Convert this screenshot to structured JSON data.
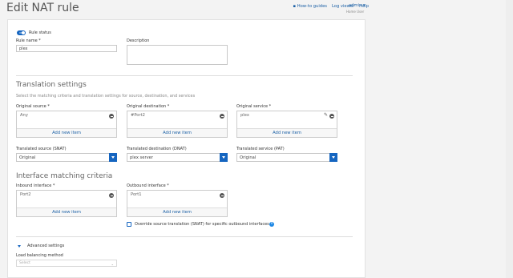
{
  "page": {
    "title": "Edit NAT rule"
  },
  "toplinks": {
    "howto": "How-to guides",
    "log": "Log viewer",
    "help": "Help",
    "user": "admin ▾",
    "role": "Home User"
  },
  "rule": {
    "toggle_text": "ON",
    "status_label": "Rule status",
    "name_label": "Rule name *",
    "name_value": "plex",
    "desc_label": "Description",
    "desc_value": ""
  },
  "translation": {
    "title": "Translation settings",
    "hint": "Select the matching criteria and translation settings for source, destination, and services",
    "orig_source_label": "Original source *",
    "orig_source_item": "Any",
    "orig_dest_label": "Original destination *",
    "orig_dest_item": "#Port2",
    "orig_service_label": "Original service *",
    "orig_service_item": "plex",
    "add_new": "Add new item",
    "snat_label": "Translated source (SNAT)",
    "snat_value": "Original",
    "dnat_label": "Translated destination (DNAT)",
    "dnat_value": "plex server",
    "pat_label": "Translated service (PAT)",
    "pat_value": "Original"
  },
  "interface": {
    "title": "Interface matching criteria",
    "inbound_label": "Inbound interface *",
    "inbound_item": "Port2",
    "outbound_label": "Outbound interface *",
    "outbound_item": "Port1",
    "override_label": "Override source translation (SNAT) for specific outbound interfaces"
  },
  "advanced": {
    "label": "Advanced settings",
    "lb_label": "Load balancing method",
    "lb_placeholder": "Select"
  }
}
